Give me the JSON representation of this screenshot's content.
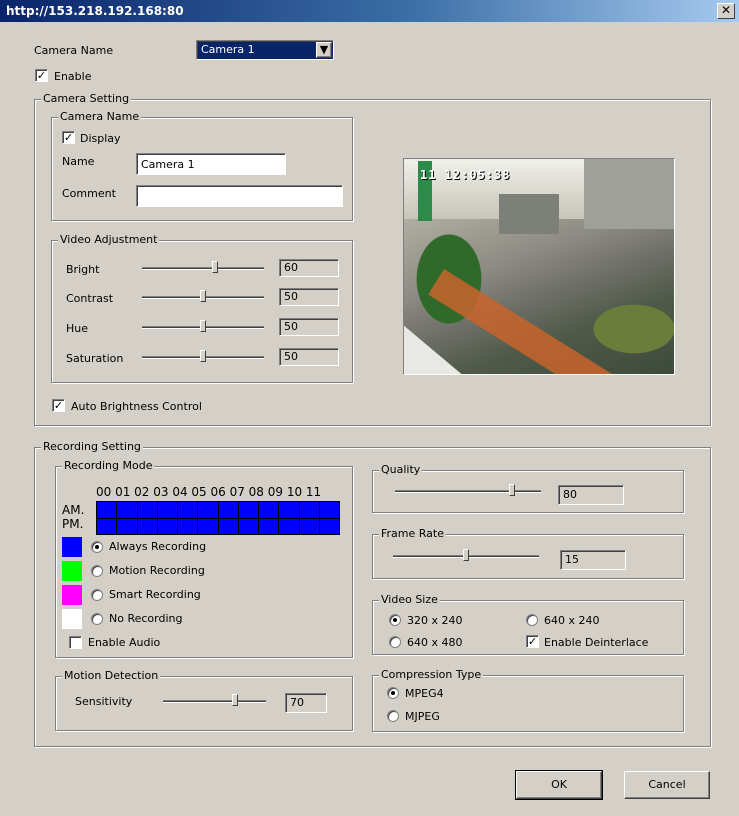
{
  "window": {
    "title": "http://153.218.192.168:80"
  },
  "top": {
    "camera_name_label": "Camera Name",
    "camera_select_value": "Camera 1",
    "enable_label": "Enable",
    "enable_checked": true
  },
  "camera_setting": {
    "title": "Camera Setting",
    "camera_name": {
      "title": "Camera Name",
      "display_label": "Display",
      "name_label": "Name",
      "name_value": "Camera 1",
      "comment_label": "Comment",
      "comment_value": ""
    },
    "video_adjustment": {
      "title": "Video Adjustment",
      "sliders": [
        {
          "label": "Bright",
          "value": "60",
          "level": 0.6
        },
        {
          "label": "Contrast",
          "value": "50",
          "level": 0.5
        },
        {
          "label": "Hue",
          "value": "50",
          "level": 0.5
        },
        {
          "label": "Saturation",
          "value": "50",
          "level": 0.5
        }
      ]
    },
    "auto_brightness_label": "Auto Brightness Control",
    "preview_timestamp": "11 12:05:38"
  },
  "recording_setting": {
    "title": "Recording Setting",
    "recording_mode": {
      "title": "Recording Mode",
      "hours": "00 01 02 03 04 05 06 07 08 09 10 11",
      "am_label": "AM.",
      "pm_label": "PM.",
      "options": [
        {
          "label": "Always Recording",
          "color": "#0000ff",
          "selected": true
        },
        {
          "label": "Motion Recording",
          "color": "#00ff00",
          "selected": false
        },
        {
          "label": "Smart Recording",
          "color": "#ff00ff",
          "selected": false
        },
        {
          "label": "No Recording",
          "color": "#ffffff",
          "selected": false
        }
      ],
      "enable_audio_label": "Enable Audio"
    },
    "motion_detection": {
      "title": "Motion Detection",
      "sensitivity_label": "Sensitivity",
      "sensitivity_value": "70",
      "sensitivity_level": 0.7
    },
    "quality": {
      "title": "Quality",
      "value": "80",
      "level": 0.8
    },
    "frame_rate": {
      "title": "Frame Rate",
      "value": "15",
      "level": 0.5
    },
    "video_size": {
      "title": "Video Size",
      "opt_320x240": "320 x 240",
      "opt_640x240": "640 x 240",
      "opt_640x480": "640 x 480",
      "enable_deinterlace_label": "Enable Deinterlace"
    },
    "compression_type": {
      "title": "Compression Type",
      "opt_mpeg4": "MPEG4",
      "opt_mjpeg": "MJPEG"
    }
  },
  "buttons": {
    "ok": "OK",
    "cancel": "Cancel"
  }
}
